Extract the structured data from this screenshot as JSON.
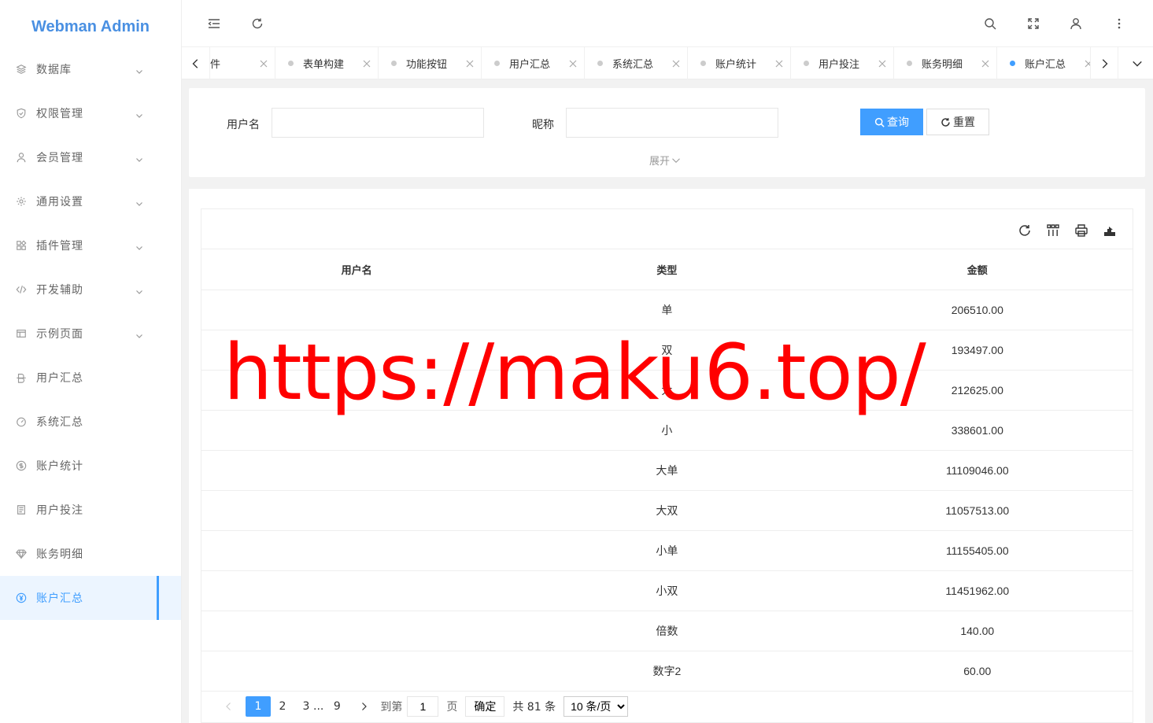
{
  "app": {
    "title": "Webman Admin"
  },
  "sidebar": {
    "items": [
      {
        "label": "数据库",
        "icon": "layers-icon",
        "has_children": true
      },
      {
        "label": "权限管理",
        "icon": "shield-check-icon",
        "has_children": true
      },
      {
        "label": "会员管理",
        "icon": "user-icon",
        "has_children": true
      },
      {
        "label": "通用设置",
        "icon": "gear-icon",
        "has_children": true
      },
      {
        "label": "插件管理",
        "icon": "apps-icon",
        "has_children": true
      },
      {
        "label": "开发辅助",
        "icon": "code-icon",
        "has_children": true
      },
      {
        "label": "示例页面",
        "icon": "layout-icon",
        "has_children": true
      },
      {
        "label": "用户汇总",
        "icon": "strike-icon",
        "has_children": false
      },
      {
        "label": "系统汇总",
        "icon": "gauge-icon",
        "has_children": false
      },
      {
        "label": "账户统计",
        "icon": "dollar-circle-icon",
        "has_children": false
      },
      {
        "label": "用户投注",
        "icon": "receipt-icon",
        "has_children": false
      },
      {
        "label": "账务明细",
        "icon": "diamond-icon",
        "has_children": false
      },
      {
        "label": "账户汇总",
        "icon": "yen-circle-icon",
        "has_children": false,
        "active": true
      }
    ]
  },
  "tabs": [
    {
      "label": "插件",
      "active": false,
      "partial": true
    },
    {
      "label": "表单构建",
      "active": false
    },
    {
      "label": "功能按钮",
      "active": false
    },
    {
      "label": "用户汇总",
      "active": false
    },
    {
      "label": "系统汇总",
      "active": false
    },
    {
      "label": "账户统计",
      "active": false
    },
    {
      "label": "用户投注",
      "active": false
    },
    {
      "label": "账务明细",
      "active": false
    },
    {
      "label": "账户汇总",
      "active": true
    }
  ],
  "search": {
    "username_label": "用户名",
    "username_value": "",
    "nickname_label": "昵称",
    "nickname_value": "",
    "query_label": "查询",
    "reset_label": "重置",
    "expand_label": "展开"
  },
  "table": {
    "columns": [
      "用户名",
      "类型",
      "金额"
    ],
    "rows": [
      [
        "",
        "单",
        "206510.00"
      ],
      [
        "",
        "双",
        "193497.00"
      ],
      [
        "",
        "大",
        "212625.00"
      ],
      [
        "",
        "小",
        "338601.00"
      ],
      [
        "",
        "大单",
        "11109046.00"
      ],
      [
        "",
        "大双",
        "11057513.00"
      ],
      [
        "",
        "小单",
        "11155405.00"
      ],
      [
        "",
        "小双",
        "11451962.00"
      ],
      [
        "",
        "倍数",
        "140.00"
      ],
      [
        "",
        "数字2",
        "60.00"
      ]
    ]
  },
  "pagination": {
    "pages": [
      "1",
      "2",
      "3"
    ],
    "ellipsis": "...",
    "last_page": "9",
    "current": "1",
    "goto_label": "到第",
    "goto_value": "1",
    "page_unit": "页",
    "confirm_label": "确定",
    "total_label": "共 81 条",
    "page_size": "10 条/页"
  },
  "watermark": {
    "text": "https://maku6.top/"
  },
  "colors": {
    "primary": "#409eff",
    "brand": "#4a90e2",
    "watermark": "#ff0000"
  }
}
